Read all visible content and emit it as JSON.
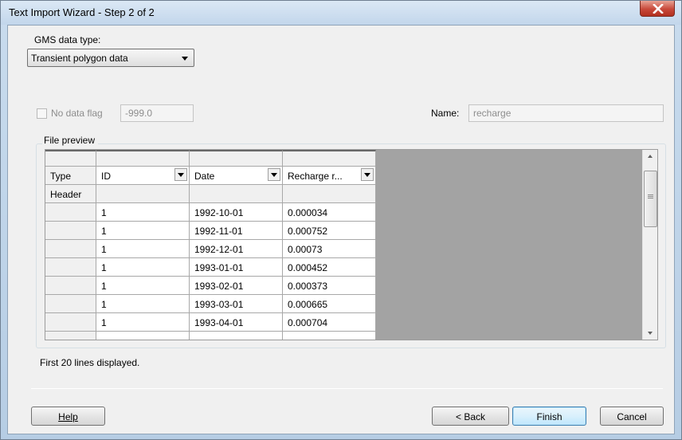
{
  "window": {
    "title": "Text Import Wizard - Step 2 of 2"
  },
  "gms": {
    "label": "GMS data type:",
    "selected": "Transient polygon data"
  },
  "no_data": {
    "checkbox_label": "No data flag",
    "value": "-999.0",
    "checked": false
  },
  "name": {
    "label": "Name:",
    "value": "recharge"
  },
  "preview": {
    "group_label": "File preview",
    "row_labels": [
      "Type",
      "Header",
      "",
      "",
      "",
      "",
      "",
      "",
      ""
    ],
    "columns": [
      {
        "type": "ID",
        "header": ""
      },
      {
        "type": "Date",
        "header": ""
      },
      {
        "type": "Recharge r...",
        "header": ""
      }
    ],
    "rows": [
      [
        "1",
        "1992-10-01",
        "0.000034"
      ],
      [
        "1",
        "1992-11-01",
        "0.000752"
      ],
      [
        "1",
        "1992-12-01",
        "0.00073"
      ],
      [
        "1",
        "1993-01-01",
        "0.000452"
      ],
      [
        "1",
        "1993-02-01",
        "0.000373"
      ],
      [
        "1",
        "1993-03-01",
        "0.000665"
      ],
      [
        "1",
        "1993-04-01",
        "0.000704"
      ]
    ],
    "status": "First 20 lines displayed."
  },
  "buttons": {
    "help": "Help",
    "back": "< Back",
    "finish": "Finish",
    "cancel": "Cancel"
  },
  "colors": {
    "title_gradient": "#c2d6eb",
    "close_red": "#c8493a",
    "grid_empty": "#a3a3a3"
  }
}
